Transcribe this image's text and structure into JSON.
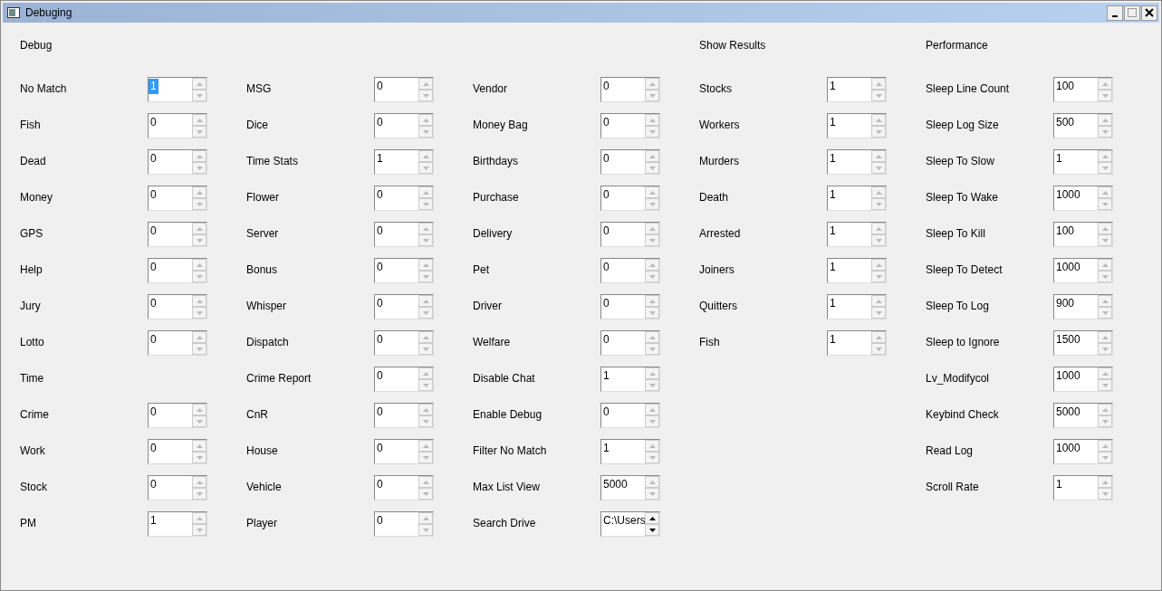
{
  "window": {
    "title": "Debuging"
  },
  "columns": [
    {
      "header": "Debug",
      "rows": [
        {
          "label": "No Match",
          "value": "1",
          "selected": true,
          "arrows_disabled": true
        },
        {
          "label": "Fish",
          "value": "0",
          "selected": false,
          "arrows_disabled": true
        },
        {
          "label": "Dead",
          "value": "0",
          "selected": false,
          "arrows_disabled": true
        },
        {
          "label": "Money",
          "value": "0",
          "selected": false,
          "arrows_disabled": true
        },
        {
          "label": "GPS",
          "value": "0",
          "selected": false,
          "arrows_disabled": true
        },
        {
          "label": "Help",
          "value": "0",
          "selected": false,
          "arrows_disabled": true
        },
        {
          "label": "Jury",
          "value": "0",
          "selected": false,
          "arrows_disabled": true
        },
        {
          "label": "Lotto",
          "value": "0",
          "selected": false,
          "arrows_disabled": true
        },
        {
          "label": "Time"
        },
        {
          "label": "Crime",
          "value": "0",
          "selected": false,
          "arrows_disabled": true
        },
        {
          "label": "Work",
          "value": "0",
          "selected": false,
          "arrows_disabled": true
        },
        {
          "label": "Stock",
          "value": "0",
          "selected": false,
          "arrows_disabled": true
        },
        {
          "label": "PM",
          "value": "1",
          "selected": false,
          "arrows_disabled": true
        }
      ]
    },
    {
      "rows": [
        {
          "label": "MSG",
          "value": "0",
          "selected": false,
          "arrows_disabled": true
        },
        {
          "label": "Dice",
          "value": "0",
          "selected": false,
          "arrows_disabled": true
        },
        {
          "label": "Time Stats",
          "value": "1",
          "selected": false,
          "arrows_disabled": true
        },
        {
          "label": "Flower",
          "value": "0",
          "selected": false,
          "arrows_disabled": true
        },
        {
          "label": "Server",
          "value": "0",
          "selected": false,
          "arrows_disabled": true
        },
        {
          "label": "Bonus",
          "value": "0",
          "selected": false,
          "arrows_disabled": true
        },
        {
          "label": "Whisper",
          "value": "0",
          "selected": false,
          "arrows_disabled": true
        },
        {
          "label": "Dispatch",
          "value": "0",
          "selected": false,
          "arrows_disabled": true
        },
        {
          "label": "Crime Report",
          "value": "0",
          "selected": false,
          "arrows_disabled": true
        },
        {
          "label": "CnR",
          "value": "0",
          "selected": false,
          "arrows_disabled": true
        },
        {
          "label": "House",
          "value": "0",
          "selected": false,
          "arrows_disabled": true
        },
        {
          "label": "Vehicle",
          "value": "0",
          "selected": false,
          "arrows_disabled": true
        },
        {
          "label": "Player",
          "value": "0",
          "selected": false,
          "arrows_disabled": true
        }
      ]
    },
    {
      "rows": [
        {
          "label": "Vendor",
          "value": "0",
          "selected": false,
          "arrows_disabled": true
        },
        {
          "label": "Money Bag",
          "value": "0",
          "selected": false,
          "arrows_disabled": true
        },
        {
          "label": "Birthdays",
          "value": "0",
          "selected": false,
          "arrows_disabled": true
        },
        {
          "label": "Purchase",
          "value": "0",
          "selected": false,
          "arrows_disabled": true
        },
        {
          "label": "Delivery",
          "value": "0",
          "selected": false,
          "arrows_disabled": true
        },
        {
          "label": "Pet",
          "value": "0",
          "selected": false,
          "arrows_disabled": true
        },
        {
          "label": "Driver",
          "value": "0",
          "selected": false,
          "arrows_disabled": true
        },
        {
          "label": "Welfare",
          "value": "0",
          "selected": false,
          "arrows_disabled": true
        },
        {
          "label": "Disable Chat",
          "value": "1",
          "selected": false,
          "arrows_disabled": true
        },
        {
          "label": "Enable Debug",
          "value": "0",
          "selected": false,
          "arrows_disabled": true
        },
        {
          "label": "Filter No Match",
          "value": "1",
          "selected": false,
          "arrows_disabled": true
        },
        {
          "label": "Max List View",
          "value": "5000",
          "selected": false,
          "arrows_disabled": true
        },
        {
          "label": "Search Drive",
          "value": "C:\\Users",
          "selected": false,
          "arrows_disabled": false
        }
      ]
    },
    {
      "header": "Show Results",
      "rows": [
        {
          "label": "Stocks",
          "value": "1",
          "selected": false,
          "arrows_disabled": true
        },
        {
          "label": "Workers",
          "value": "1",
          "selected": false,
          "arrows_disabled": true
        },
        {
          "label": "Murders",
          "value": "1",
          "selected": false,
          "arrows_disabled": true
        },
        {
          "label": "Death",
          "value": "1",
          "selected": false,
          "arrows_disabled": true
        },
        {
          "label": "Arrested",
          "value": "1",
          "selected": false,
          "arrows_disabled": true
        },
        {
          "label": "Joiners",
          "value": "1",
          "selected": false,
          "arrows_disabled": true
        },
        {
          "label": "Quitters",
          "value": "1",
          "selected": false,
          "arrows_disabled": true
        },
        {
          "label": "Fish",
          "value": "1",
          "selected": false,
          "arrows_disabled": true
        }
      ]
    },
    {
      "header": "Performance",
      "rows": [
        {
          "label": "Sleep Line Count",
          "value": "100",
          "selected": false,
          "arrows_disabled": true
        },
        {
          "label": "Sleep Log Size",
          "value": "500",
          "selected": false,
          "arrows_disabled": true
        },
        {
          "label": "Sleep To Slow",
          "value": "1",
          "selected": false,
          "arrows_disabled": true
        },
        {
          "label": "Sleep To Wake",
          "value": "1000",
          "selected": false,
          "arrows_disabled": true
        },
        {
          "label": "Sleep To Kill",
          "value": "100",
          "selected": false,
          "arrows_disabled": true
        },
        {
          "label": "Sleep To Detect",
          "value": "1000",
          "selected": false,
          "arrows_disabled": true
        },
        {
          "label": "Sleep To Log",
          "value": "900",
          "selected": false,
          "arrows_disabled": true
        },
        {
          "label": "Sleep to Ignore",
          "value": "1500",
          "selected": false,
          "arrows_disabled": true
        },
        {
          "label": "Lv_Modifycol",
          "value": "1000",
          "selected": false,
          "arrows_disabled": true
        },
        {
          "label": "Keybind Check",
          "value": "5000",
          "selected": false,
          "arrows_disabled": true
        },
        {
          "label": "Read Log",
          "value": "1000",
          "selected": false,
          "arrows_disabled": true
        },
        {
          "label": "Scroll Rate",
          "value": "1",
          "selected": false,
          "arrows_disabled": true
        }
      ]
    }
  ]
}
